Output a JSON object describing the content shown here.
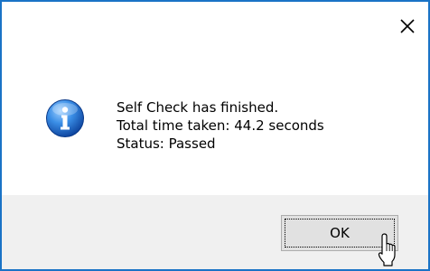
{
  "dialog": {
    "close_glyph": "×",
    "icon": "info-icon",
    "message": {
      "line1": "Self Check has finished.",
      "line2": "Total time taken: 44.2 seconds",
      "line3": "Status: Passed"
    },
    "ok_label": "OK"
  },
  "colors": {
    "border": "#1a73c6",
    "footer": "#f0f0f0",
    "button": "#e1e1e1"
  }
}
